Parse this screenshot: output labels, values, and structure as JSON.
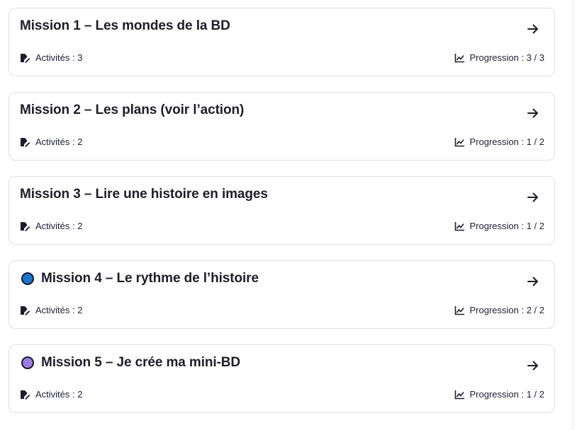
{
  "missions": [
    {
      "title": "Mission 1 – Les mondes de la BD",
      "activities": "Activités : 3",
      "progress": "Progression : 3 / 3",
      "status_color": null
    },
    {
      "title": "Mission 2 – Les plans (voir l’action)",
      "activities": "Activités : 2",
      "progress": "Progression : 1 / 2",
      "status_color": null
    },
    {
      "title": "Mission 3 – Lire une histoire en images",
      "activities": "Activités : 2",
      "progress": "Progression : 1 / 2",
      "status_color": null
    },
    {
      "title": "Mission 4 – Le rythme de l’histoire",
      "activities": "Activités : 2",
      "progress": "Progression : 2 / 2",
      "status_color": "#1677d2"
    },
    {
      "title": "Mission 5 – Je crée ma mini-BD",
      "activities": "Activités : 2",
      "progress": "Progression : 1 / 2",
      "status_color": "#9b7be6"
    }
  ],
  "icons": {
    "activities": "edit-document-icon",
    "progress": "line-chart-icon",
    "open": "arrow-right-icon"
  }
}
